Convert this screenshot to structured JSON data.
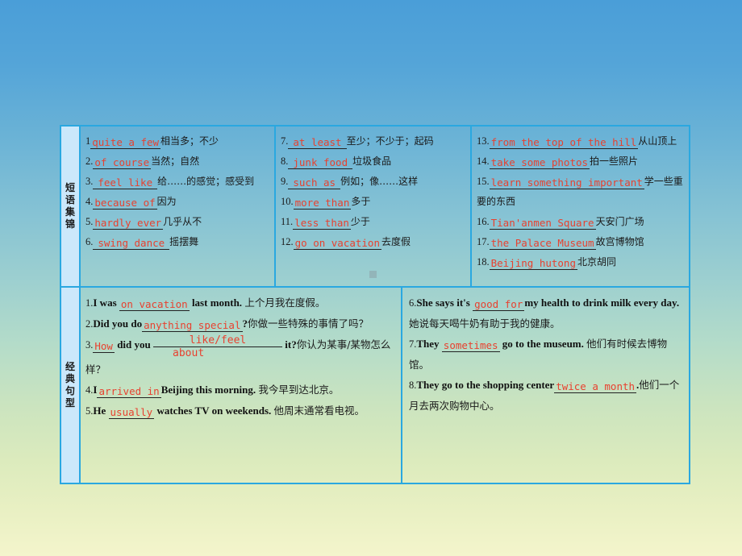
{
  "sections": [
    {
      "label": "短语集锦",
      "label_chars": [
        "短",
        "语",
        "集",
        "锦"
      ],
      "columns": [
        {
          "items": [
            {
              "num": "1",
              "answer": "quite a few",
              "meaning": "相当多；不少"
            },
            {
              "num": "2.",
              "answer": " of course ",
              "meaning": "当然；自然"
            },
            {
              "num": "3.",
              "answer": " feel like",
              "meaning": "给……的感觉；感受到"
            },
            {
              "num": "4.",
              "answer": " because of ",
              "meaning": "因为"
            },
            {
              "num": "5.",
              "answer": " hardly ever ",
              "meaning": "几乎从不"
            },
            {
              "num": "6.",
              "answer": "swing dance ",
              "meaning": "摇摆舞"
            }
          ]
        },
        {
          "items": [
            {
              "num": "7.",
              "answer": " at least ",
              "meaning": "至少；不少于；起码"
            },
            {
              "num": "8.",
              "answer": " junk food ",
              "meaning": "垃圾食品"
            },
            {
              "num": "9.",
              "answer": " such as ",
              "meaning": "例如；像……这样"
            },
            {
              "num": "10.",
              "answer": " more than ",
              "meaning": "多于"
            },
            {
              "num": "11.",
              "answer": " less than",
              "meaning": "少于"
            },
            {
              "num": "12.",
              "answer": " go on vacation ",
              "meaning": "去度假"
            }
          ]
        },
        {
          "items": [
            {
              "num": "13.",
              "answer": "from the top of the hill",
              "meaning": "从山顶上"
            },
            {
              "num": "14.",
              "answer": "take some photos ",
              "meaning": "拍一些照片"
            },
            {
              "num": "15.",
              "answer": "learn something important ",
              "meaning": "学一些重要的东西"
            },
            {
              "num": "16.",
              "answer": "Tian'anmen Square ",
              "meaning": "天安门广场"
            },
            {
              "num": "17.",
              "answer": "the Palace Museum ",
              "meaning": "故宫博物馆"
            },
            {
              "num": "18.",
              "answer": "Beijing hutong ",
              "meaning": "北京胡同"
            }
          ]
        }
      ]
    },
    {
      "label": "经典句型",
      "label_chars": [
        "经",
        "典",
        "句",
        "型"
      ],
      "sentences_left": [
        {
          "num": "1.",
          "pre": "I was ",
          "answer": "on vacation ",
          "post": " last month. ",
          "cn": "上个月我在度假。"
        },
        {
          "num": "2.",
          "pre": "Did you do",
          "answer": "anything special",
          "post": "?",
          "cn": "你做一些特殊的事情了吗？"
        },
        {
          "num": "3.",
          "pre": "",
          "answer": " How ",
          "mid": " did you ",
          "stacked_answer_line1": "like/feel",
          "stacked_answer_line2": "about",
          "post": " it?",
          "cn": "你认为某事/某物怎么样？"
        },
        {
          "num": "4.",
          "pre": "I",
          "answer": "arrived in",
          "post": "Beijing this morning. ",
          "cn": "我今早到达北京。"
        },
        {
          "num": "5.",
          "pre": "He ",
          "answer": "usually ",
          "post": " watches TV on weekends. ",
          "cn": "他周末通常看电视。"
        }
      ],
      "sentences_right": [
        {
          "num": "6.",
          "pre": "She says it's ",
          "answer": "good for ",
          "post": "my health to drink milk every day.",
          "cn": "她说每天喝牛奶有助于我的健康。"
        },
        {
          "num": "7.",
          "pre": "They ",
          "answer": "sometimes ",
          "post": " go to the museum. ",
          "cn": "他们有时候去博物馆。"
        },
        {
          "num": "8.",
          "pre": "They go to the shopping center",
          "answer": "twice a month ",
          "post": ".",
          "cn": "他们一个月去两次购物中心。"
        }
      ]
    }
  ],
  "colors": {
    "answer_red": "#e8412f",
    "border_blue": "#2aa8e0",
    "label_bg": "#cbe8fb",
    "bg_top": "#4a9ed8",
    "bg_bottom": "#f4f5cc"
  }
}
